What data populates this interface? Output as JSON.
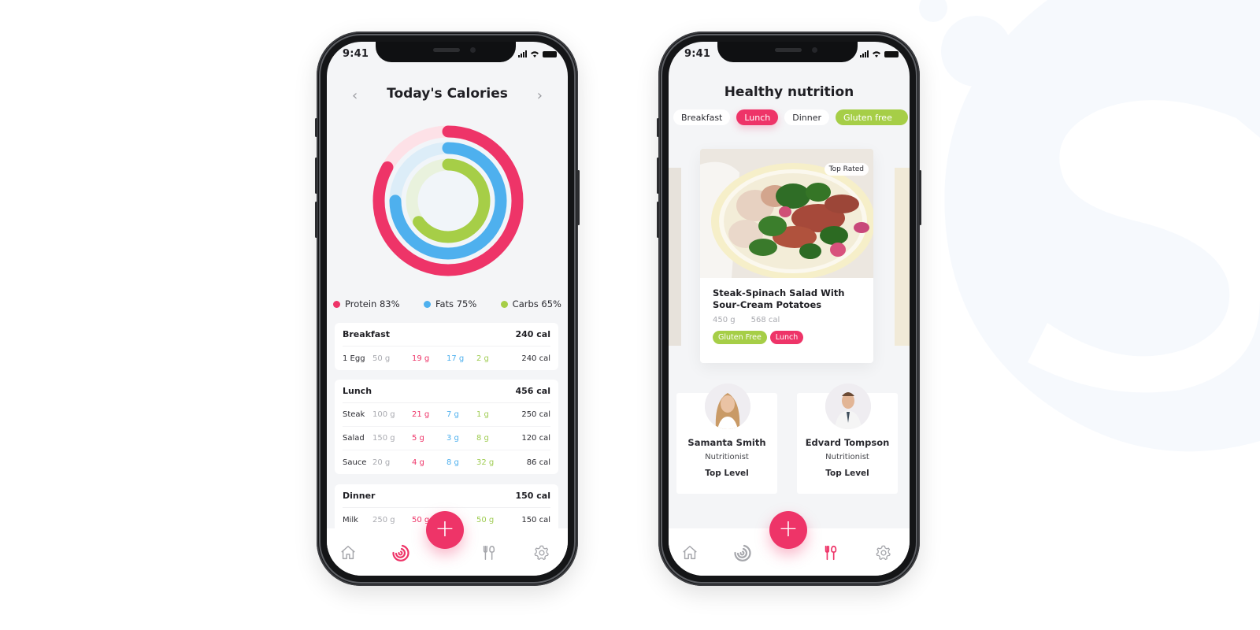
{
  "colors": {
    "protein": "#ee3468",
    "fats": "#4eb0ee",
    "carbs": "#a6ce47",
    "accent": "#ee3468",
    "inactive_icon": "#a5a6ab"
  },
  "status_bar": {
    "time": "9:41"
  },
  "calories_screen": {
    "title": "Today's Calories",
    "prev_icon": "chevron-left-icon",
    "next_icon": "chevron-right-icon",
    "rings": [
      {
        "name": "Protein",
        "percent": 83
      },
      {
        "name": "Fats",
        "percent": 75
      },
      {
        "name": "Carbs",
        "percent": 65
      }
    ],
    "legend": [
      {
        "label": "Protein 83%"
      },
      {
        "label": "Fats 75%"
      },
      {
        "label": "Carbs 65%"
      }
    ],
    "meals": [
      {
        "name": "Breakfast",
        "total": "240 cal",
        "items": [
          {
            "food": "1 Egg",
            "weight": "50 g",
            "protein": "19 g",
            "fats": "17 g",
            "carbs": "2 g",
            "cal": "240 cal"
          }
        ]
      },
      {
        "name": "Lunch",
        "total": "456 cal",
        "items": [
          {
            "food": "Steak",
            "weight": "100 g",
            "protein": "21 g",
            "fats": "7 g",
            "carbs": "1 g",
            "cal": "250 cal"
          },
          {
            "food": "Salad",
            "weight": "150 g",
            "protein": "5 g",
            "fats": "3 g",
            "carbs": "8 g",
            "cal": "120 cal"
          },
          {
            "food": "Sauce",
            "weight": "20 g",
            "protein": "4 g",
            "fats": "8 g",
            "carbs": "32 g",
            "cal": "86 cal"
          }
        ]
      },
      {
        "name": "Dinner",
        "total": "150 cal",
        "items": [
          {
            "food": "Milk",
            "weight": "250 g",
            "protein": "50 g",
            "fats": "",
            "carbs": "50 g",
            "cal": "150 cal"
          }
        ]
      }
    ],
    "fab_label": "+",
    "tabbar": [
      "home-icon",
      "progress-icon",
      "cutlery-icon",
      "settings-icon"
    ],
    "active_tab": "progress-icon"
  },
  "nutrition_screen": {
    "title": "Healthy nutrition",
    "chips": [
      {
        "label": "Breakfast",
        "state": "default"
      },
      {
        "label": "Lunch",
        "state": "active"
      },
      {
        "label": "Dinner",
        "state": "default"
      },
      {
        "label": "Gluten free",
        "state": "green"
      }
    ],
    "recipe": {
      "badge": "Top Rated",
      "title": "Steak-Spinach Salad With Sour-Cream Potatoes",
      "weight": "450 g",
      "calories": "568 cal",
      "tags": [
        {
          "label": "Gluten Free",
          "color": "#a6ce47"
        },
        {
          "label": "Lunch",
          "color": "#ee3468"
        }
      ]
    },
    "nutritionists": [
      {
        "name": "Samanta Smith",
        "role": "Nutritionist",
        "level": "Top Level"
      },
      {
        "name": "Edvard Tompson",
        "role": "Nutritionist",
        "level": "Top Level"
      }
    ],
    "fab_label": "+",
    "tabbar": [
      "home-icon",
      "progress-icon",
      "cutlery-icon",
      "settings-icon"
    ],
    "active_tab": "cutlery-icon"
  }
}
